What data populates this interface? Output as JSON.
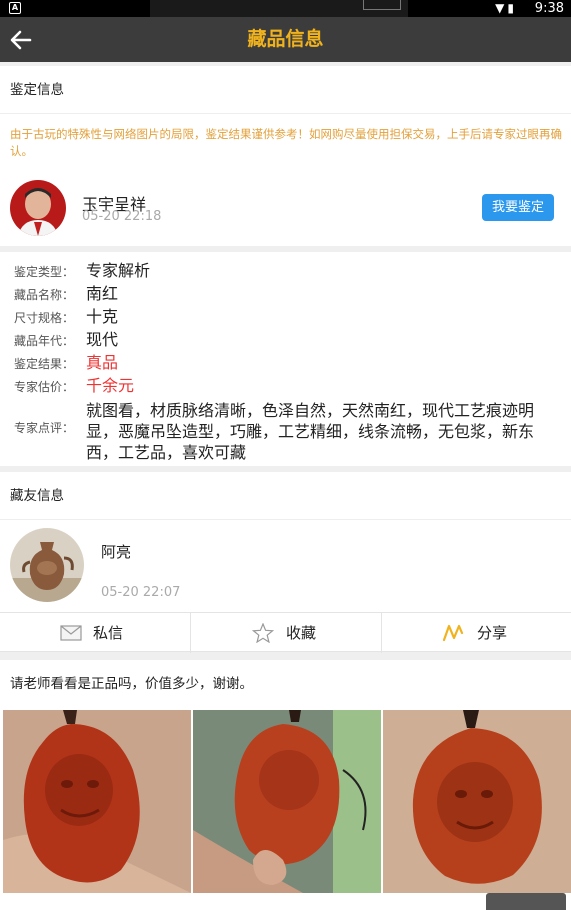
{
  "status_bar": {
    "time": "9:38",
    "notif_icon": "A"
  },
  "header": {
    "title": "藏品信息"
  },
  "appraisal": {
    "section_title": "鉴定信息",
    "notice": "由于古玩的特殊性与网络图片的局限，鉴定结果谨供参考！如网购尽量使用担保交易，上手后请专家过眼再确认。",
    "expert_name": "玉宇呈祥",
    "expert_time": "05-20 22:18",
    "request_button": "我要鉴定"
  },
  "details": [
    {
      "label": "鉴定类型：",
      "value": "专家解析",
      "highlight": false
    },
    {
      "label": "藏品名称：",
      "value": "南红",
      "highlight": false
    },
    {
      "label": "尺寸规格：",
      "value": "十克",
      "highlight": false
    },
    {
      "label": "藏品年代：",
      "value": "现代",
      "highlight": false
    },
    {
      "label": "鉴定结果：",
      "value": "真品",
      "highlight": true
    },
    {
      "label": "专家估价：",
      "value": "千余元",
      "highlight": true
    }
  ],
  "comment": {
    "label": "专家点评：",
    "text": "就图看，材质脉络清晰，色泽自然，天然南红，现代工艺痕迹明显，恶魔吊坠造型，巧雕，工艺精细，线条流畅，无包浆，新东西，工艺品，喜欢可藏"
  },
  "owner": {
    "section_title": "藏友信息",
    "name": "阿亮",
    "time": "05-20 22:07"
  },
  "actions": [
    {
      "label": "私信",
      "icon": "mail-icon"
    },
    {
      "label": "收藏",
      "icon": "star-icon"
    },
    {
      "label": "分享",
      "icon": "share-icon"
    }
  ],
  "question": "请老师看看是正品吗，价值多少，谢谢。",
  "colors": {
    "accent": "#f0b31e",
    "button": "#2b98ee",
    "red": "#e33333",
    "notice": "#e3a03a"
  }
}
